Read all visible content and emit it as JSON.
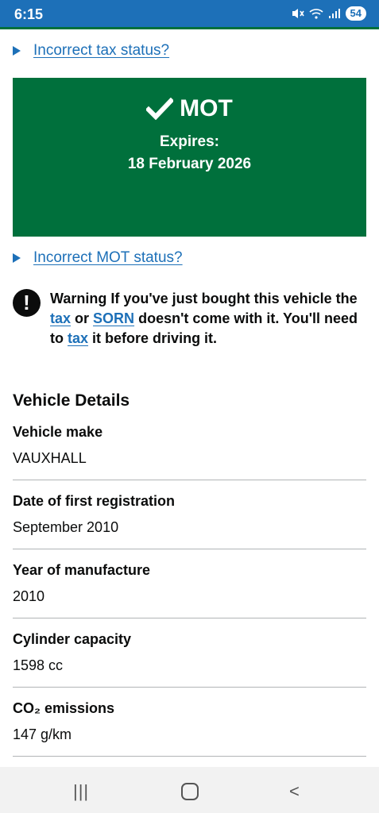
{
  "status_bar": {
    "time": "6:15",
    "battery": "54",
    "icons": [
      "mute-icon",
      "wifi-icon",
      "signal-icon"
    ]
  },
  "links": {
    "tax_status": "Incorrect tax status?",
    "mot_status": "Incorrect MOT status?"
  },
  "mot": {
    "title": "MOT",
    "expires_label": "Expires:",
    "expiry_date": "18 February 2026"
  },
  "warning": {
    "icon_glyph": "!",
    "label": "Warning",
    "text_1": "If you've just bought this vehicle the",
    "link_tax": "tax",
    "text_2": "or",
    "link_sorn": "SORN",
    "text_3": "doesn't come with it. You'll need to",
    "link_tax_2": "tax",
    "text_4": "it before driving it."
  },
  "vehicle_details": {
    "title": "Vehicle Details",
    "rows": [
      {
        "label": "Vehicle make",
        "value": "VAUXHALL"
      },
      {
        "label": "Date of first registration",
        "value": "September 2010"
      },
      {
        "label": "Year of manufacture",
        "value": "2010"
      },
      {
        "label": "Cylinder capacity",
        "value": "1598 cc"
      },
      {
        "label": "CO₂ emissions",
        "value": "147 g/km"
      }
    ]
  },
  "nav_bar": {
    "recents": "|||",
    "back": "<"
  },
  "colors": {
    "link": "#1d70b8",
    "panel_green": "#00703c",
    "text": "#0b0c0c",
    "status_bar": "#1d70b8"
  }
}
